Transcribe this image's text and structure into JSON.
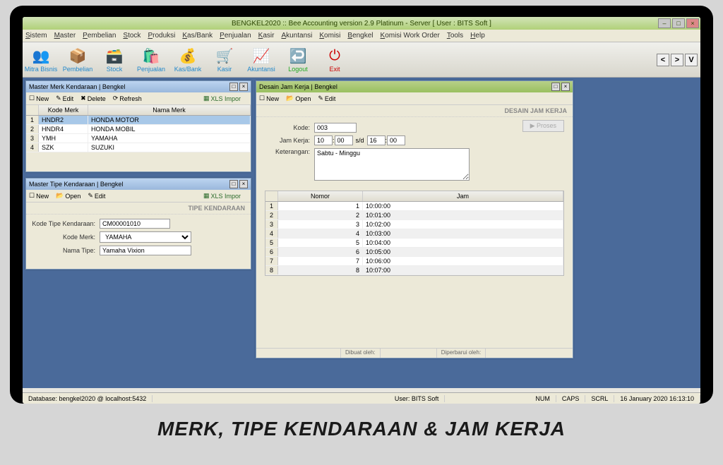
{
  "window": {
    "title": "BENGKEL2020 :: Bee Accounting version 2.9 Platinum - Server  [ User : BITS Soft ]"
  },
  "menus": [
    "Sistem",
    "Master",
    "Pembelian",
    "Stock",
    "Produksi",
    "Kas/Bank",
    "Penjualan",
    "Kasir",
    "Akuntansi",
    "Komisi",
    "Bengkel",
    "Komisi Work Order",
    "Tools",
    "Help"
  ],
  "toolbar": [
    {
      "label": "Mitra Bisnis",
      "emoji": "👥"
    },
    {
      "label": "Pembelian",
      "emoji": "📦"
    },
    {
      "label": "Stock",
      "emoji": "🗃️"
    },
    {
      "label": "Penjualan",
      "emoji": "🛍️"
    },
    {
      "label": "Kas/Bank",
      "emoji": "💰"
    },
    {
      "label": "Kasir",
      "emoji": "🛒"
    },
    {
      "label": "Akuntansi",
      "emoji": "📈"
    },
    {
      "label": "Logout",
      "emoji": "↩️"
    },
    {
      "label": "Exit",
      "emoji": "⏻"
    }
  ],
  "merk": {
    "title": "Master Merk Kendaraan | Bengkel",
    "buttons": {
      "new": "New",
      "edit": "Edit",
      "delete": "Delete",
      "refresh": "Refresh",
      "xls": "XLS Impor"
    },
    "cols": {
      "kode": "Kode Merk",
      "nama": "Nama Merk"
    },
    "rows": [
      {
        "kode": "HNDR2",
        "nama": "HONDA MOTOR"
      },
      {
        "kode": "HNDR4",
        "nama": "HONDA MOBIL"
      },
      {
        "kode": "YMH",
        "nama": "YAMAHA"
      },
      {
        "kode": "SZK",
        "nama": "SUZUKI"
      }
    ]
  },
  "tipe": {
    "title": "Master Tipe Kendaraan | Bengkel",
    "buttons": {
      "new": "New",
      "open": "Open",
      "edit": "Edit",
      "xls": "XLS Impor"
    },
    "section": "TIPE KENDARAAN",
    "labels": {
      "kode": "Kode Tipe Kendaraan:",
      "merk": "Kode Merk:",
      "nama": "Nama Tipe:"
    },
    "values": {
      "kode": "CM00001010",
      "merk": "YAMAHA",
      "nama": "Yamaha Vixion"
    }
  },
  "jam": {
    "title": "Desain Jam Kerja | Bengkel",
    "buttons": {
      "new": "New",
      "open": "Open",
      "edit": "Edit"
    },
    "section": "DESAIN JAM KERJA",
    "labels": {
      "kode": "Kode:",
      "jamkerja": "Jam Kerja:",
      "sd": "s/d",
      "ket": "Keterangan:",
      "proses": "Proses"
    },
    "values": {
      "kode": "003",
      "h1": "10",
      "m1": "00",
      "h2": "16",
      "m2": "00",
      "ket": "Sabtu - Minggu"
    },
    "gridcols": {
      "nomor": "Nomor",
      "jam": "Jam"
    },
    "gridrows": [
      {
        "n": "1",
        "jam": "1 10:00:00"
      },
      {
        "n": "2",
        "jam": "2 10:01:00"
      },
      {
        "n": "3",
        "jam": "3 10:02:00"
      },
      {
        "n": "4",
        "jam": "4 10:03:00"
      },
      {
        "n": "5",
        "jam": "5 10:04:00"
      },
      {
        "n": "6",
        "jam": "6 10:05:00"
      },
      {
        "n": "7",
        "jam": "7 10:06:00"
      },
      {
        "n": "8",
        "jam": "8 10:07:00"
      }
    ],
    "substatus": {
      "dibuat": "Dibuat oleh:",
      "diperbarui": "Diperbarui oleh:"
    }
  },
  "status": {
    "db": "Database: bengkel2020 @ localhost:5432",
    "user": "User: BITS Soft",
    "num": "NUM",
    "caps": "CAPS",
    "scrl": "SCRL",
    "date": "16 January 2020  16:13:10"
  },
  "caption": "MERK, TIPE KENDARAAN & JAM KERJA"
}
